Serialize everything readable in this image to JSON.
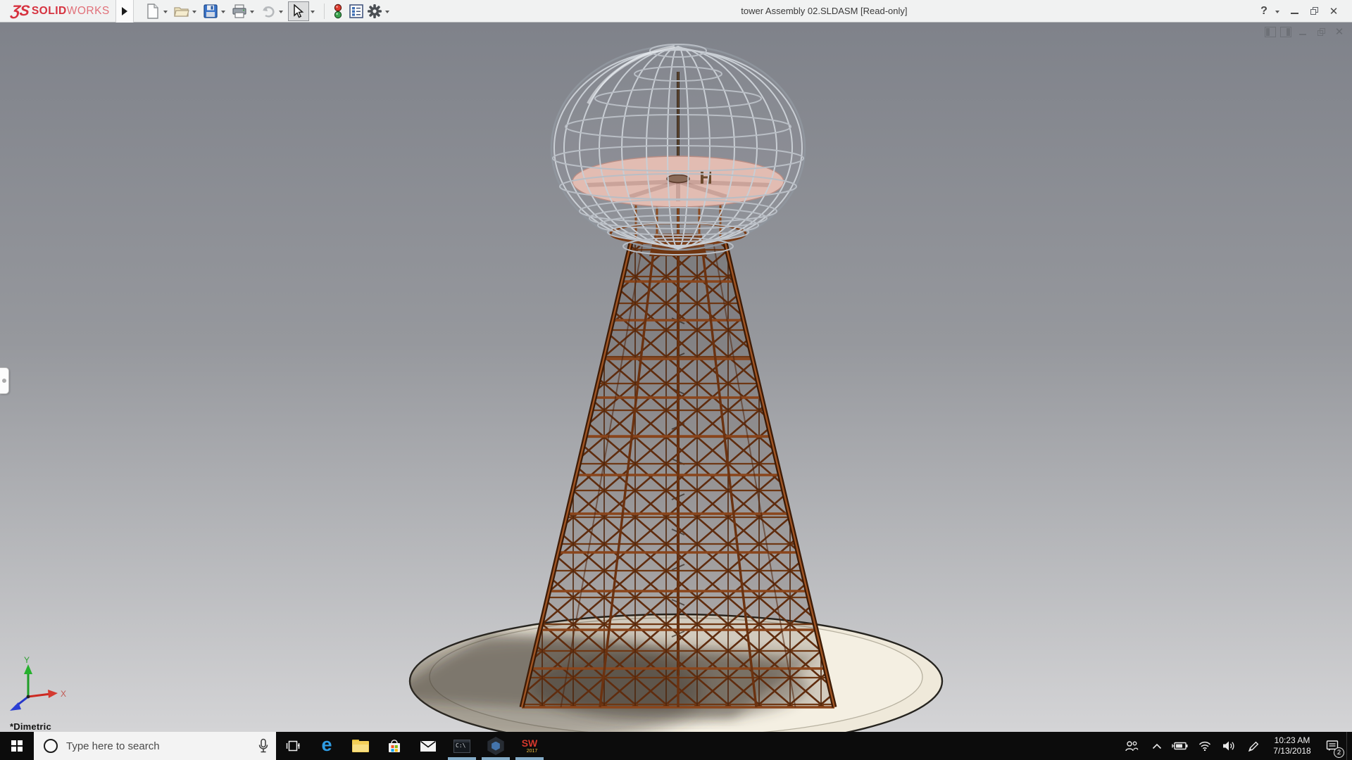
{
  "window": {
    "logo": {
      "mark": "ƷS",
      "name_bold": "SOLID",
      "name_light": "WORKS"
    },
    "title": "tower Assembly 02.SLDASM [Read-only]",
    "toolbar_icons": [
      "menu-expander",
      "new-document",
      "open",
      "save",
      "print",
      "undo",
      "select-cursor",
      "rebuild-traffic-light",
      "file-properties",
      "options-gear"
    ],
    "window_controls": [
      "help",
      "minimize",
      "restore",
      "close"
    ]
  },
  "viewport": {
    "view_orientation_label": "*Dimetric",
    "triad": {
      "x_label": "X",
      "y_label": "Y"
    },
    "document_window_controls": [
      "pane-toggle-left",
      "pane-toggle-right",
      "minimize",
      "restore",
      "close"
    ],
    "colors": {
      "background_top": "#7f828a",
      "background_bottom": "#d4d4d6",
      "tower_wood": "#7d3e16",
      "dome_metal": "#c9ced4",
      "dome_platform_disc": "#e2bcb2",
      "base_platform": "#efe9da"
    }
  },
  "taskbar": {
    "search_placeholder": "Type here to search",
    "app_icons": [
      {
        "name": "task-view",
        "running": false
      },
      {
        "name": "microsoft-edge",
        "running": false
      },
      {
        "name": "file-explorer",
        "running": false
      },
      {
        "name": "microsoft-store",
        "running": false
      },
      {
        "name": "mail",
        "running": false
      },
      {
        "name": "command-prompt",
        "running": true
      },
      {
        "name": "edrawings",
        "running": true
      },
      {
        "name": "solidworks-2017",
        "running": true
      }
    ],
    "command_prompt_text": "C:\\",
    "solidworks_icon_text": {
      "letters": "SW",
      "year": "2017"
    },
    "tray_icons": [
      "people",
      "hidden-icons-chevron",
      "battery",
      "wifi",
      "volume",
      "pen"
    ],
    "clock": {
      "time": "10:23 AM",
      "date": "7/13/2018"
    },
    "action_center_badge": "2"
  }
}
